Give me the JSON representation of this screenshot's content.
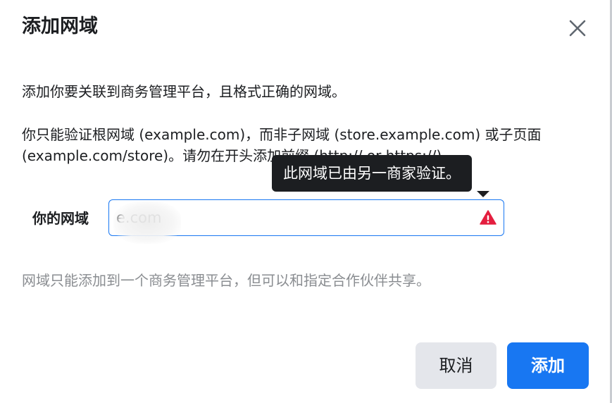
{
  "dialog": {
    "title": "添加网域",
    "description_1": "添加你要关联到商务管理平台，且格式正确的网域。",
    "description_2": "你只能验证根网域 (example.com)，而非子网域 (store.example.com) 或子页面 (example.com/store)。请勿在开头添加前缀 (http:// or https://)。",
    "field_label": "你的网域",
    "field_value": "e.com",
    "tooltip": "此网域已由另一商家验证。",
    "hint": "网域只能添加到一个商务管理平台，但可以和指定合作伙伴共享。",
    "cancel_label": "取消",
    "add_label": "添加"
  },
  "colors": {
    "primary": "#1877f2",
    "warning": "#e41e3f",
    "tooltip_bg": "#1c1e21",
    "secondary_button_bg": "#e4e6eb",
    "hint_text": "#8a8d91"
  },
  "icons": {
    "close": "close-icon",
    "warning": "warning-triangle-icon"
  }
}
